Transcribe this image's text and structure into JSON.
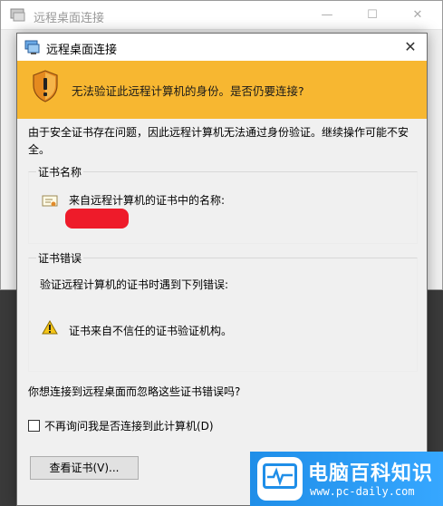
{
  "background_window": {
    "title": "远程桌面连接",
    "minimize": "—",
    "maximize": "☐",
    "close": "✕"
  },
  "dialog": {
    "title": "远程桌面连接",
    "close": "✕",
    "banner_message": "无法验证此远程计算机的身份。是否仍要连接?",
    "description": "由于安全证书存在问题，因此远程计算机无法通过身份验证。继续操作可能不安全。",
    "cert_name_group": {
      "label": "证书名称",
      "line": "来自远程计算机的证书中的名称:"
    },
    "cert_errors_group": {
      "label": "证书错误",
      "intro": "验证远程计算机的证书时遇到下列错误:",
      "item": "证书来自不信任的证书验证机构。"
    },
    "question": "你想连接到远程桌面而忽略这些证书错误吗?",
    "dont_ask_checkbox": {
      "label": "不再询问我是否连接到此计算机(D)",
      "checked": false
    },
    "buttons": {
      "view_cert": "查看证书(V)...",
      "yes": "",
      "no": ""
    }
  },
  "watermark": {
    "title": "电脑百科知识",
    "url": "www.pc-daily.com"
  },
  "colors": {
    "banner": "#f7b731",
    "redaction": "#ee1b2a",
    "watermark": "#1f8ee8",
    "arrow": "#e8262d"
  }
}
